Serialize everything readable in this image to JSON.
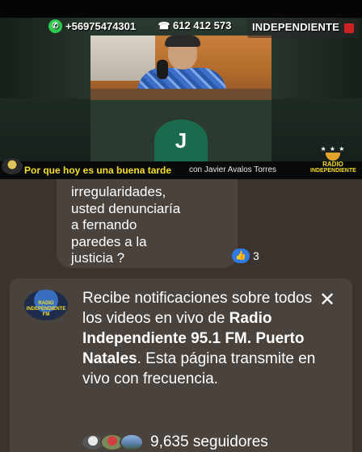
{
  "broadcast": {
    "whatsapp_number": "+56975474301",
    "phone_number": "612 412 573",
    "station_logo_text": "INDEPENDIENTE",
    "participant_initial": "J",
    "tagline": "Por que hoy es una buena tarde",
    "host_credit": "con Javier Avalos Torres",
    "radio_logo_line1": "RADIO",
    "radio_logo_line2": "INDEPENDIENTE",
    "radio_logo_stars": "★ ★ ★"
  },
  "comment": {
    "text_lines": [
      "irregularidades,",
      "usted denunciaría",
      "a fernando",
      "paredes a la",
      "justicia ?"
    ],
    "reaction_count": "3"
  },
  "notification": {
    "avatar_text_1": "RADIO",
    "avatar_text_2": "INDEPENDIENTE",
    "avatar_text_3": "FM",
    "text_prefix": "Recibe notificaciones sobre todos los videos en vivo de ",
    "page_name": "Radio Independiente 95.1 FM. Puerto Natales",
    "text_suffix": ". Esta página transmite en vivo con frecuencia.",
    "close_glyph": "✕",
    "followers": "9,635 seguidores"
  },
  "colors": {
    "background": "#3a332e",
    "card": "#4a423c",
    "tagline_yellow": "#f5df2c",
    "like_blue": "#2f7ae5",
    "avatar_green": "#1c6a4d",
    "whatsapp_green": "#2ecc51"
  },
  "icons": {
    "whatsapp": "whatsapp-icon",
    "phone": "phone-icon",
    "like": "like-icon",
    "close": "close-icon"
  }
}
